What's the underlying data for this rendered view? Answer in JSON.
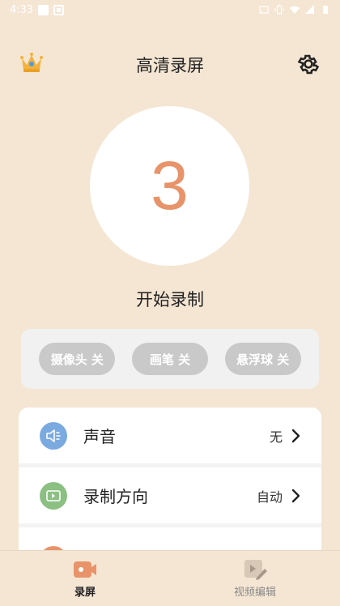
{
  "status_bar": {
    "time": "4:33"
  },
  "header": {
    "title": "高清录屏"
  },
  "countdown": {
    "value": "3"
  },
  "start": {
    "label": "开始录制"
  },
  "toggles": [
    {
      "label": "摄像头 关"
    },
    {
      "label": "画笔 关"
    },
    {
      "label": "悬浮球 关"
    }
  ],
  "settings": [
    {
      "label": "声音",
      "value": "无"
    },
    {
      "label": "录制方向",
      "value": "自动"
    }
  ],
  "bottom_nav": [
    {
      "label": "录屏",
      "active": true
    },
    {
      "label": "视频编辑",
      "active": false
    }
  ],
  "colors": {
    "accent": "#e8936a",
    "background": "#f5e6d4"
  }
}
